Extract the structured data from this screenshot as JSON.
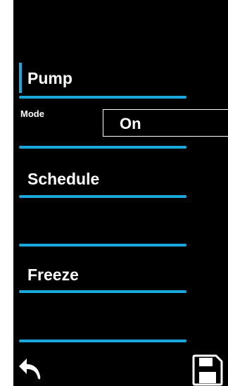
{
  "menu": {
    "pump_label": "Pump",
    "mode_label": "Mode",
    "mode_value": "On",
    "schedule_label": "Schedule",
    "freeze_label": "Freeze"
  },
  "icons": {
    "back": "back-arrow-icon",
    "save": "save-floppy-icon"
  },
  "colors": {
    "accent": "#1aa7dc",
    "background": "#000000",
    "text": "#ffffff"
  }
}
